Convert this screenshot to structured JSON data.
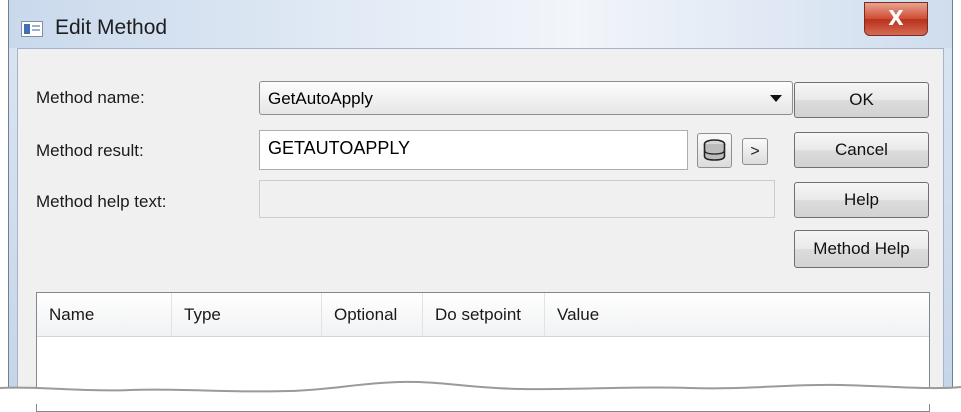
{
  "window": {
    "title": "Edit Method",
    "close_label": "X"
  },
  "form": {
    "method_name_label": "Method name:",
    "method_name_value": "GetAutoApply",
    "method_result_label": "Method result:",
    "method_result_value": "GETAUTOAPPLY",
    "expand_button_label": ">",
    "method_help_text_label": "Method help text:",
    "method_help_text_value": ""
  },
  "buttons": {
    "ok": "OK",
    "cancel": "Cancel",
    "help": "Help",
    "method_help": "Method Help"
  },
  "table": {
    "columns": [
      "Name",
      "Type",
      "Optional",
      "Do setpoint",
      "Value"
    ],
    "rows": []
  },
  "icons": {
    "app": "window-app-icon",
    "close": "close-icon",
    "dropdown": "chevron-down-icon",
    "browse": "database-icon",
    "expand": "chevron-right-icon"
  }
}
